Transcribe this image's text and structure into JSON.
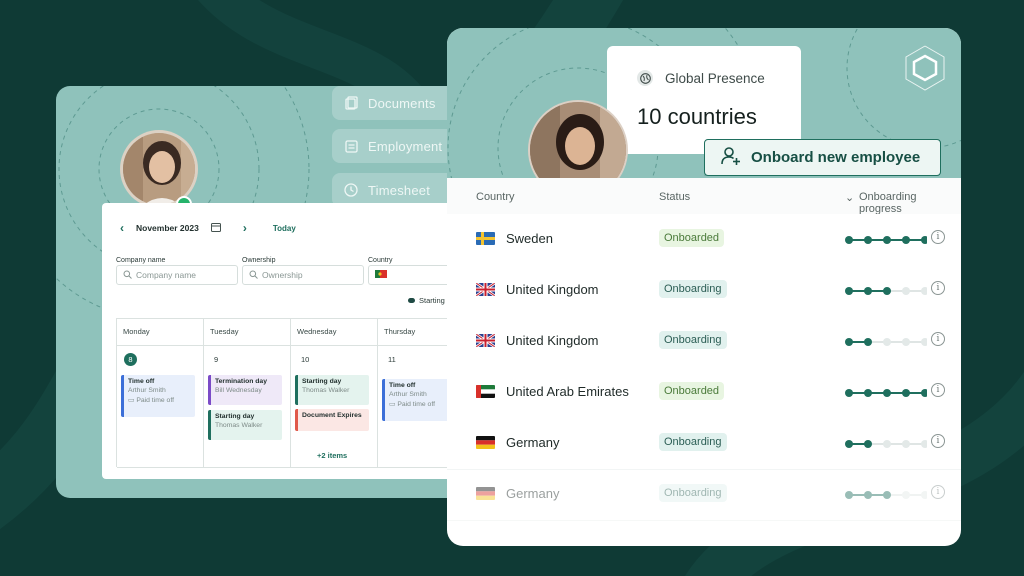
{
  "colors": {
    "accent": "#1f6f5e",
    "online": "#26b36b",
    "card_teal": "#8fc2bb",
    "page_bg": "#0f3a35"
  },
  "sidebar": {
    "items": [
      {
        "label": "Documents",
        "icon": "documents-icon"
      },
      {
        "label": "Employment",
        "icon": "employment-icon"
      },
      {
        "label": "Timesheet",
        "icon": "clock-icon"
      }
    ]
  },
  "calendar": {
    "month": "November 2023",
    "today": "Today",
    "filters": {
      "company_label": "Company name",
      "company_placeholder": "Company name",
      "ownership_label": "Ownership",
      "ownership_placeholder": "Ownership",
      "country_label": "Country"
    },
    "legend": "Starting",
    "days": [
      "Monday",
      "Tuesday",
      "Wednesday",
      "Thursday"
    ],
    "dates": [
      "8",
      "9",
      "10",
      "11"
    ],
    "events": {
      "mon": {
        "title": "Time off",
        "person": "Arthur Smith",
        "sub": "Paid time off"
      },
      "tue1": {
        "title": "Termination day",
        "person": "Bill Wednesday"
      },
      "tue2": {
        "title": "Starting day",
        "person": "Thomas Walker"
      },
      "wed1": {
        "title": "Starting day",
        "person": "Thomas Walker"
      },
      "wed2": {
        "title": "Document Expires"
      },
      "wed_more": "+2 items",
      "thu": {
        "title": "Time off",
        "person": "Arthur Smith",
        "sub": "Paid time off"
      }
    }
  },
  "presence": {
    "label": "Global Presence",
    "value": "10 countries"
  },
  "onboard_button": "Onboard new employee",
  "table": {
    "headers": {
      "country": "Country",
      "status": "Status",
      "progress": "Onboarding progress"
    },
    "rows": [
      {
        "country": "Sweden",
        "status": "Onboarded",
        "progress": 5,
        "total": 5,
        "flag": "se"
      },
      {
        "country": "United Kingdom",
        "status": "Onboarding",
        "progress": 3,
        "total": 5,
        "flag": "gb"
      },
      {
        "country": "United Kingdom",
        "status": "Onboarding",
        "progress": 2,
        "total": 5,
        "flag": "gb"
      },
      {
        "country": "United Arab Emirates",
        "status": "Onboarded",
        "progress": 5,
        "total": 5,
        "flag": "ae"
      },
      {
        "country": "Germany",
        "status": "Onboarding",
        "progress": 2,
        "total": 5,
        "flag": "de"
      },
      {
        "country": "Germany",
        "status": "Onboarding",
        "progress": 3,
        "total": 5,
        "flag": "de"
      }
    ]
  }
}
